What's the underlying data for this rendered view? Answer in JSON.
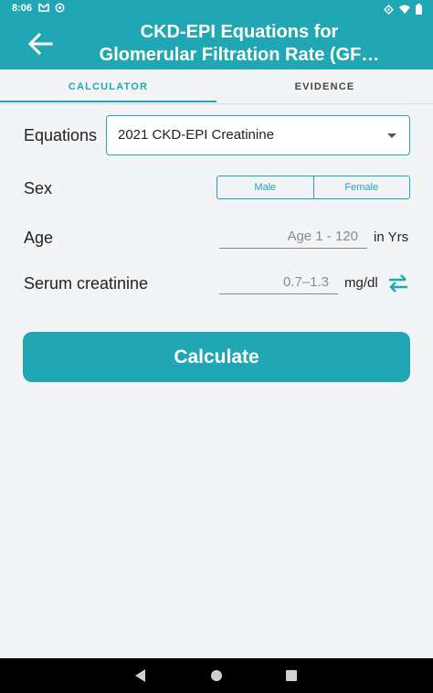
{
  "status_bar": {
    "time": "8:06"
  },
  "app_bar": {
    "title_line1": "CKD-EPI Equations for",
    "title_line2": "Glomerular Filtration Rate (GF…"
  },
  "tabs": [
    {
      "label": "CALCULATOR",
      "active": true
    },
    {
      "label": "EVIDENCE",
      "active": false
    }
  ],
  "form": {
    "equations": {
      "label": "Equations",
      "value": "2021 CKD-EPI Creatinine"
    },
    "sex": {
      "label": "Sex",
      "options": [
        "Male",
        "Female"
      ]
    },
    "age": {
      "label": "Age",
      "placeholder": "Age 1 - 120",
      "unit": "in Yrs"
    },
    "creatinine": {
      "label": "Serum creatinine",
      "placeholder": "0.7–1.3",
      "unit": "mg/dl"
    }
  },
  "calculate_label": "Calculate",
  "colors": {
    "accent": "#20a7b3",
    "background": "#f3f4f6"
  }
}
